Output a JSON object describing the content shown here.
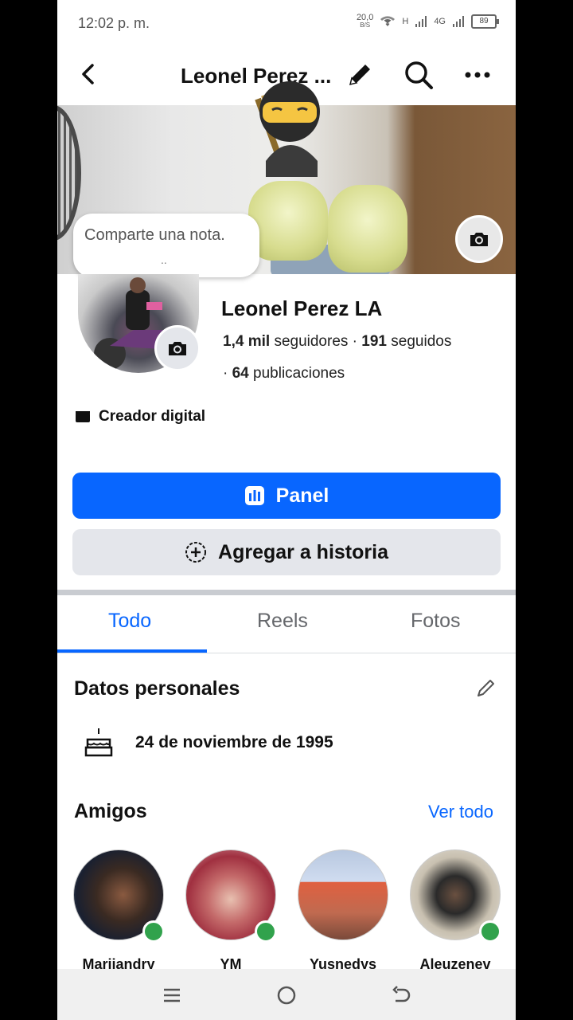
{
  "status_bar": {
    "time": "12:02 p. m.",
    "net_speed": "20,0",
    "net_unit": "B/S",
    "network_type": "H",
    "network_type2": "4G",
    "battery": "89"
  },
  "top_bar": {
    "title": "Leonel Perez ..."
  },
  "cover": {
    "note_placeholder": "Comparte una nota.",
    "note_dots": ".."
  },
  "profile": {
    "name": "Leonel Perez LA",
    "followers_count": "1,4 mil",
    "followers_label": "seguidores",
    "following_count": "191",
    "following_label": "seguidos",
    "posts_count": "64",
    "posts_label": "publicaciones",
    "category": "Creador digital"
  },
  "actions": {
    "primary": "Panel",
    "secondary": "Agregar a historia"
  },
  "tabs": [
    {
      "label": "Todo",
      "active": true
    },
    {
      "label": "Reels",
      "active": false
    },
    {
      "label": "Fotos",
      "active": false
    }
  ],
  "personal": {
    "title": "Datos personales",
    "birthday": "24 de noviembre de 1995"
  },
  "friends": {
    "title": "Amigos",
    "see_all": "Ver todo",
    "items": [
      {
        "name": "Marijandry",
        "online": true
      },
      {
        "name": "YM",
        "online": true
      },
      {
        "name": "Yusnedys",
        "online": false
      },
      {
        "name": "Aleuzenev",
        "online": true
      }
    ]
  },
  "colors": {
    "accent": "#0866ff",
    "online": "#31a24c"
  }
}
